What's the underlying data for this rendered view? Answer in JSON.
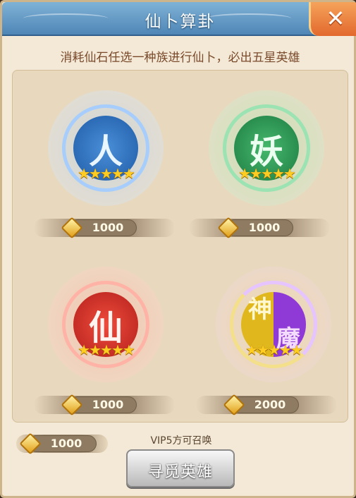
{
  "window": {
    "title": "仙卜算卦",
    "close_label": "✕"
  },
  "subtitle": "消耗仙石任选一种族进行仙卜，必出五星英雄",
  "races": [
    {
      "glyph": "人",
      "stars": "★★★★★",
      "cost": "1000"
    },
    {
      "glyph": "妖",
      "stars": "★★★★★",
      "cost": "1000"
    },
    {
      "glyph": "仙",
      "stars": "★★★★★",
      "cost": "1000"
    },
    {
      "glyph_left": "神",
      "glyph_right": "魔",
      "stars": "★★★★★",
      "cost": "2000"
    }
  ],
  "footer": {
    "balance": "1000",
    "vip_note": "VIP5方可召唤",
    "summon_label": "寻觅英雄"
  },
  "colors": {
    "title_bar": "#4f86b6",
    "close_button": "#e2682e",
    "human": "#1f5ba6",
    "demon": "#1d7c43",
    "immortal": "#b4201c",
    "god": "#e0b81d",
    "mo": "#8f3ad6",
    "star": "#ffcc22"
  },
  "icons": {
    "currency": "spirit-stone-icon",
    "star": "star-icon",
    "close": "close-icon"
  }
}
